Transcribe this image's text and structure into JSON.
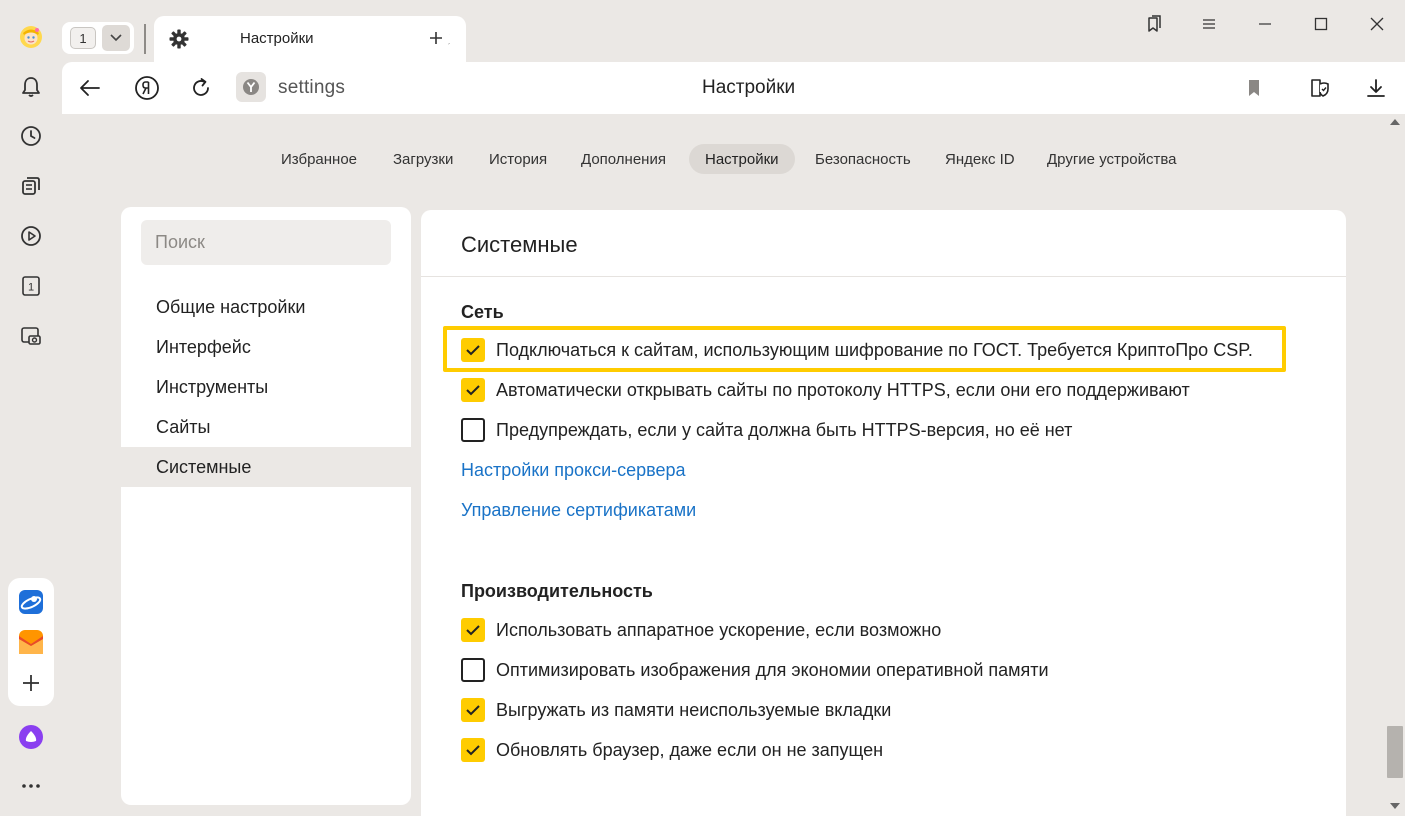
{
  "browser": {
    "tab_count": "1",
    "active_tab": {
      "title": "Настройки",
      "icon": "gear-icon"
    },
    "url": "settings",
    "page_title": "Настройки"
  },
  "nav_tabs": [
    {
      "label": "Избранное",
      "active": false
    },
    {
      "label": "Загрузки",
      "active": false
    },
    {
      "label": "История",
      "active": false
    },
    {
      "label": "Дополнения",
      "active": false
    },
    {
      "label": "Настройки",
      "active": true
    },
    {
      "label": "Безопасность",
      "active": false
    },
    {
      "label": "Яндекс ID",
      "active": false
    },
    {
      "label": "Другие устройства",
      "active": false
    }
  ],
  "sidebar_menu": {
    "search_placeholder": "Поиск",
    "items": [
      {
        "label": "Общие настройки",
        "active": false
      },
      {
        "label": "Интерфейс",
        "active": false
      },
      {
        "label": "Инструменты",
        "active": false
      },
      {
        "label": "Сайты",
        "active": false
      },
      {
        "label": "Системные",
        "active": true
      }
    ]
  },
  "section": {
    "title": "Системные",
    "network": {
      "title": "Сеть",
      "options": [
        {
          "label": "Подключаться к сайтам, использующим шифрование по ГОСТ. Требуется КриптоПро CSP.",
          "checked": true,
          "highlighted": true
        },
        {
          "label": "Автоматически открывать сайты по протоколу HTTPS, если они его поддерживают",
          "checked": true
        },
        {
          "label": "Предупреждать, если у сайта должна быть HTTPS-версия, но её нет",
          "checked": false
        }
      ],
      "links": [
        "Настройки прокси-сервера",
        "Управление сертификатами"
      ]
    },
    "performance": {
      "title": "Производительность",
      "options": [
        {
          "label": "Использовать аппаратное ускорение, если возможно",
          "checked": true
        },
        {
          "label": "Оптимизировать изображения для экономии оперативной памяти",
          "checked": false
        },
        {
          "label": "Выгружать из памяти неиспользуемые вкладки",
          "checked": true
        },
        {
          "label": "Обновлять браузер, даже если он не запущен",
          "checked": true
        }
      ]
    }
  },
  "colors": {
    "accent": "#ffcc00",
    "link": "#1a73c7",
    "background": "#ebe8e5",
    "card": "#ffffff"
  },
  "sidebar_panel_icons": [
    "profile-avatar",
    "bell-icon",
    "clock-icon",
    "collections-icon",
    "play-icon",
    "tab-number-icon",
    "screenshot-icon",
    "yandex-browser-app-icon",
    "mail-app-icon",
    "plus-icon",
    "alice-icon",
    "more-icon"
  ],
  "sidebar_panel_tab_number": "1"
}
